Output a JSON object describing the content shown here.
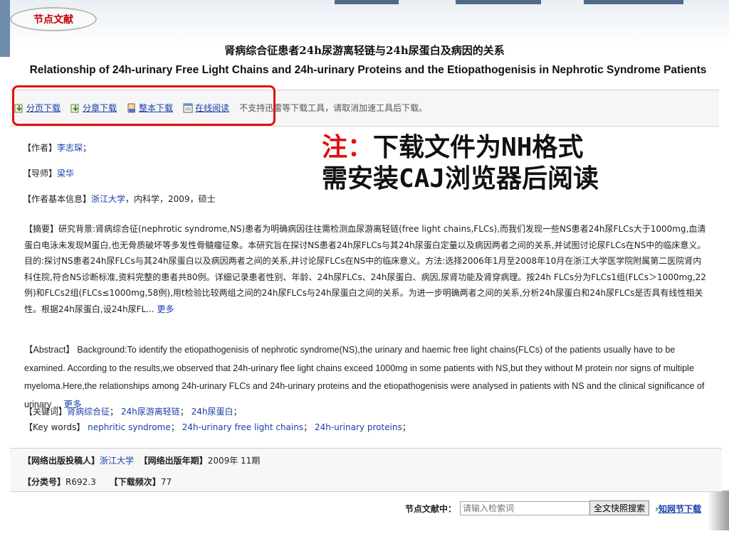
{
  "badge": "节点文献",
  "title": {
    "cn": "肾病综合征患者24h尿游离轻链与24h尿蛋白及病因的关系",
    "en": "Relationship of 24h-urinary Free Light Chains and 24h-urinary Proteins and the Etiopathogenisis in Nephrotic Syndrome Patients"
  },
  "toolbar": {
    "buttons": [
      "分页下载",
      "分章下载",
      "整本下载",
      "在线阅读"
    ],
    "note": "不支持迅雷等下载工具，请取消加速工具后下载。"
  },
  "note_overlay": {
    "prefix": "注：",
    "line1": "下载文件为NH格式",
    "line2": "需安装CAJ浏览器后阅读"
  },
  "meta": {
    "author_label": "【作者】",
    "author": "李志琛",
    "author_sep": "；",
    "advisor_label": "【导师】",
    "advisor": "梁华",
    "info_label": "【作者基本信息】",
    "school": "浙江大学",
    "info_rest": "，内科学，2009，硕士"
  },
  "abstract": {
    "label": "【摘要】",
    "text": "研究背景:肾病综合征(nephrotic syndrome,NS)患者为明确病因往往需检测血尿游离轻链(free light chains,FLCs),而我们发现一些NS患者24h尿FLCs大于1000mg,血清蛋白电泳未发现M蛋白,也无骨质破坏等多发性骨髓瘤征象。本研究旨在探讨NS患者24h尿FLCs与其24h尿蛋白定量以及病因两者之间的关系,并试图讨论尿FLCs在NS中的临床意义。目的:探讨NS患者24h尿FLCs与其24h尿蛋白以及病因两者之间的关系,并讨论尿FLCs在NS中的临床意义。方法:选择2006年1月至2008年10月在浙江大学医学院附属第二医院肾内科住院,符合NS诊断标准,资料完整的患者共80例。详细记录患者性别、年龄、24h尿FLCs、24h尿蛋白、病因,尿肾功能及肾穿病理。按24h FLCs分为FLCs1组(FLCs＞1000mg,22例)和FLCs2组(FLCs≤1000mg,58例),用t检验比较两组之间的24h尿FLCs与24h尿蛋白之间的关系。为进一步明确两者之间的关系,分析24h尿蛋白和24h尿FLCs是否具有线性相关性。根据24h尿蛋白,设24h尿FL...",
    "more": "更多"
  },
  "abstract_en": {
    "label": "【Abstract】",
    "text": "Background:To identify the etiopathogenisis of nephrotic syndrome(NS),the urinary and haemic free light chains(FLCs) of the patients usually have to be examined. According to the results,we observed that 24h-urinary flee light chains exceed 1000mg in some patients with NS,but they without M protein nor signs of multiple myeloma.Here,the relationships among 24h-urinary FLCs and 24h-urinary proteins and the etiopathogenisis were analysed in patients with NS and the clinical significance of urinary ...",
    "more": "更多"
  },
  "keywords": {
    "cn_label": "【关键词】",
    "cn": [
      "肾病综合征",
      "24h尿游离轻链",
      "24h尿蛋白"
    ],
    "en_label": "【Key words】",
    "en": [
      "nephritic syndrome",
      "24h-urinary free light chains",
      "24h-urinary proteins"
    ]
  },
  "publication": {
    "submitter_label": "【网络出版投稿人】",
    "submitter": "浙江大学",
    "date_label": "【网络出版年期】",
    "date": "2009年 11期",
    "class_label": "【分类号】",
    "class": "R692.3",
    "downloads_label": "【下载频次】",
    "downloads": "77"
  },
  "search": {
    "label": "节点文献中：",
    "placeholder": "请输入检索词",
    "button": "全文快照搜索",
    "link": "知网节下载"
  },
  "colors": {
    "link": "#1a3ea8",
    "highlight": "#e01010"
  }
}
